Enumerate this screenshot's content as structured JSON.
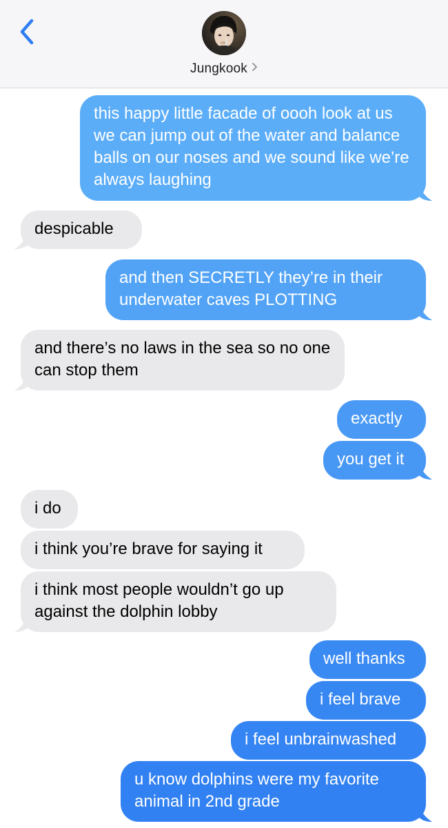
{
  "header": {
    "contact_name": "Jungkook",
    "chevron": "›",
    "icons": {
      "back": "chevron-left-icon",
      "avatar": "contact-avatar-photo"
    }
  },
  "colors": {
    "sent_top": "#5fb1f8",
    "sent_bottom": "#2f7ef2",
    "received": "#e9e9eb",
    "accent": "#2f7ef2",
    "header_bg": "#f6f6f8"
  },
  "messages": [
    {
      "from": "me",
      "text": "this happy little facade of oooh look at us we can jump out of the water and balance balls on our noses and we sound like we’re always laughing"
    },
    {
      "from": "them",
      "text": "despicable"
    },
    {
      "from": "me",
      "text": "and then SECRETLY they’re in their underwater caves PLOTTING"
    },
    {
      "from": "them",
      "text": "and there’s no laws in the sea so no one can stop them"
    },
    {
      "from": "me",
      "text": "exactly"
    },
    {
      "from": "me",
      "text": "you get it"
    },
    {
      "from": "them",
      "text": "i do"
    },
    {
      "from": "them",
      "text": "i think you’re brave for saying it"
    },
    {
      "from": "them",
      "text": "i think most people wouldn’t go up against the dolphin lobby"
    },
    {
      "from": "me",
      "text": "well thanks"
    },
    {
      "from": "me",
      "text": "i feel brave"
    },
    {
      "from": "me",
      "text": "i feel unbrainwashed"
    },
    {
      "from": "me",
      "text": "u know dolphins were my favorite animal in 2nd grade"
    }
  ]
}
